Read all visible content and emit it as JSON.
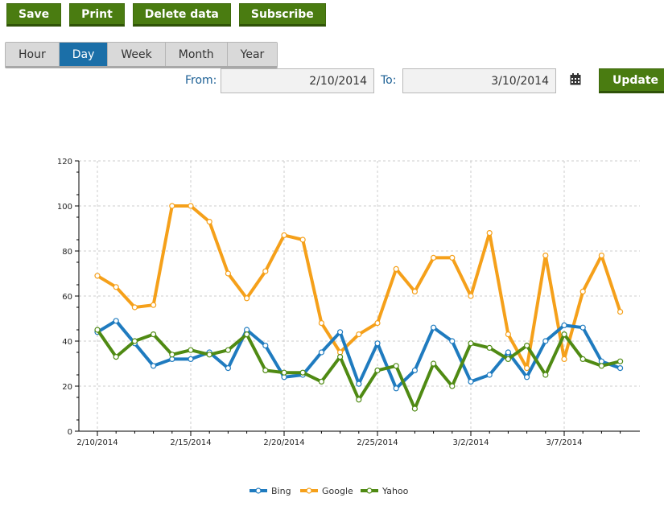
{
  "toolbar": {
    "save": "Save",
    "print": "Print",
    "delete": "Delete data",
    "subscribe": "Subscribe"
  },
  "tabs": [
    {
      "label": "Hour",
      "active": false
    },
    {
      "label": "Day",
      "active": true
    },
    {
      "label": "Week",
      "active": false
    },
    {
      "label": "Month",
      "active": false
    },
    {
      "label": "Year",
      "active": false
    }
  ],
  "range": {
    "from_label": "From:",
    "from_value": "2/10/2014",
    "to_label": "To:",
    "to_value": "3/10/2014",
    "update": "Update",
    "calendar_icon": "calendar-icon"
  },
  "colors": {
    "accent": "#4a7c11",
    "active_tab": "#1b6fa8",
    "Bing": "#1f7bbf",
    "Google": "#f5a01a",
    "Yahoo": "#4f8a13"
  },
  "chart_data": {
    "type": "line",
    "x": [
      "2/10/2014",
      "2/11/2014",
      "2/12/2014",
      "2/13/2014",
      "2/14/2014",
      "2/15/2014",
      "2/16/2014",
      "2/17/2014",
      "2/18/2014",
      "2/19/2014",
      "2/20/2014",
      "2/21/2014",
      "2/22/2014",
      "2/23/2014",
      "2/24/2014",
      "2/25/2014",
      "2/26/2014",
      "2/27/2014",
      "2/28/2014",
      "3/1/2014",
      "3/2/2014",
      "3/3/2014",
      "3/4/2014",
      "3/5/2014",
      "3/6/2014",
      "3/7/2014",
      "3/8/2014",
      "3/9/2014",
      "3/10/2014"
    ],
    "xticks": [
      "2/10/2014",
      "2/15/2014",
      "2/20/2014",
      "2/25/2014",
      "3/2/2014",
      "3/7/2014"
    ],
    "ylim": [
      0,
      120
    ],
    "yticks": [
      0,
      20,
      40,
      60,
      80,
      100,
      120
    ],
    "grid": true,
    "legend": "bottom-center",
    "series": [
      {
        "name": "Bing",
        "values": [
          44,
          49,
          39,
          29,
          32,
          32,
          35,
          28,
          45,
          38,
          24,
          25,
          35,
          44,
          21,
          39,
          19,
          27,
          46,
          40,
          22,
          25,
          35,
          24,
          40,
          47,
          46,
          31,
          28
        ]
      },
      {
        "name": "Google",
        "values": [
          69,
          64,
          55,
          56,
          100,
          100,
          93,
          70,
          59,
          71,
          87,
          85,
          48,
          35,
          43,
          48,
          72,
          62,
          77,
          77,
          60,
          88,
          43,
          28,
          78,
          32,
          62,
          78,
          53
        ]
      },
      {
        "name": "Yahoo",
        "values": [
          45,
          33,
          40,
          43,
          34,
          36,
          34,
          36,
          43,
          27,
          26,
          26,
          22,
          33,
          14,
          27,
          29,
          10,
          30,
          20,
          39,
          37,
          32,
          38,
          25,
          43,
          32,
          29,
          31
        ]
      }
    ]
  }
}
